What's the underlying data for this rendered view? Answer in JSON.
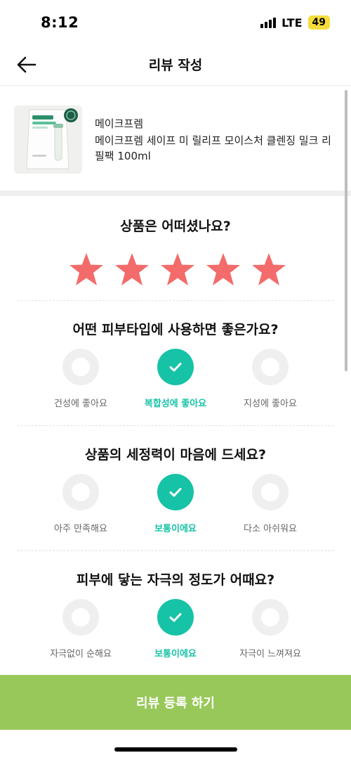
{
  "status_bar": {
    "time": "8:12",
    "network": "LTE",
    "battery": "49"
  },
  "header": {
    "title": "리뷰 작성",
    "back_icon": "arrow-left-icon"
  },
  "product": {
    "brand": "메이크프렘",
    "name": "메이크프렘 세이프 미 릴리프 모이스처 클렌징 밀크 리필팩 100ml"
  },
  "rating": {
    "question": "상품은 어떠셨나요?",
    "stars": 5,
    "max_stars": 5,
    "star_color": "#f36b6b"
  },
  "questions": [
    {
      "question": "어떤 피부타입에 사용하면 좋은가요?",
      "options": [
        {
          "label": "건성에 좋아요",
          "selected": false
        },
        {
          "label": "복합성에 좋아요",
          "selected": true
        },
        {
          "label": "지성에 좋아요",
          "selected": false
        }
      ]
    },
    {
      "question": "상품의 세정력이 마음에 드세요?",
      "options": [
        {
          "label": "아주 만족해요",
          "selected": false
        },
        {
          "label": "보통이에요",
          "selected": true
        },
        {
          "label": "다소 아쉬워요",
          "selected": false
        }
      ]
    },
    {
      "question": "피부에 닿는 자극의 정도가 어때요?",
      "options": [
        {
          "label": "자극없이 순해요",
          "selected": false
        },
        {
          "label": "보통이에요",
          "selected": true
        },
        {
          "label": "자극이 느껴져요",
          "selected": false
        }
      ]
    }
  ],
  "submit": {
    "label": "리뷰 등록 하기"
  },
  "colors": {
    "accent": "#17c3a6",
    "submit_bg": "#99c85a",
    "star": "#f36b6b"
  }
}
